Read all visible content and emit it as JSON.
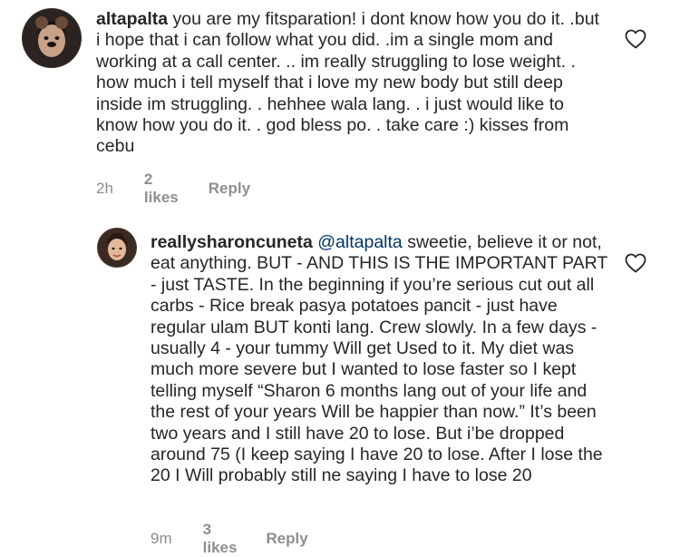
{
  "comments": [
    {
      "username": "altapalta",
      "text": " you are my fitsparation! i dont know how you do it. .but i hope that i can follow what you did. .im a single mom and working at a call center. .. im really struggling to lose weight. . how much i tell myself that i love my new body but still deep inside im struggling. .  hehhee wala lang. . i just would like to know how you do it. .  god bless po. . take care :) kisses from cebu",
      "time": "2h",
      "likes": "2 likes",
      "reply": "Reply",
      "avatar_icon": "user-avatar-icon"
    },
    {
      "username": "reallysharoncuneta",
      "mention": "@altapalta",
      "text": " sweetie, believe it or not, eat anything. BUT - AND THIS IS THE IMPORTANT PART - just TASTE. In the beginning if you’re serious cut out all carbs - Rice break pasya potatoes pancit - just have regular ulam BUT konti lang. Crew slowly. In a few days - usually 4 - your tummy Will get Used to it. My diet was much more severe but I wanted to lose faster so I kept telling myself “Sharon 6 months lang out of your life and the rest of your years Will be happier than now.” It’s been two years and I still have 20 to lose. But i’be dropped around 75 (I keep saying I have 20 to lose. After I lose the 20 I Will probably still ne saying I have to lose 20",
      "time": "9m",
      "likes": "3 likes",
      "reply": "Reply",
      "avatar_icon": "user-avatar-icon"
    }
  ],
  "icons": {
    "like": "heart-outline-icon"
  },
  "colors": {
    "text": "#262626",
    "meta": "#8e8e8e",
    "mention": "#003569"
  }
}
